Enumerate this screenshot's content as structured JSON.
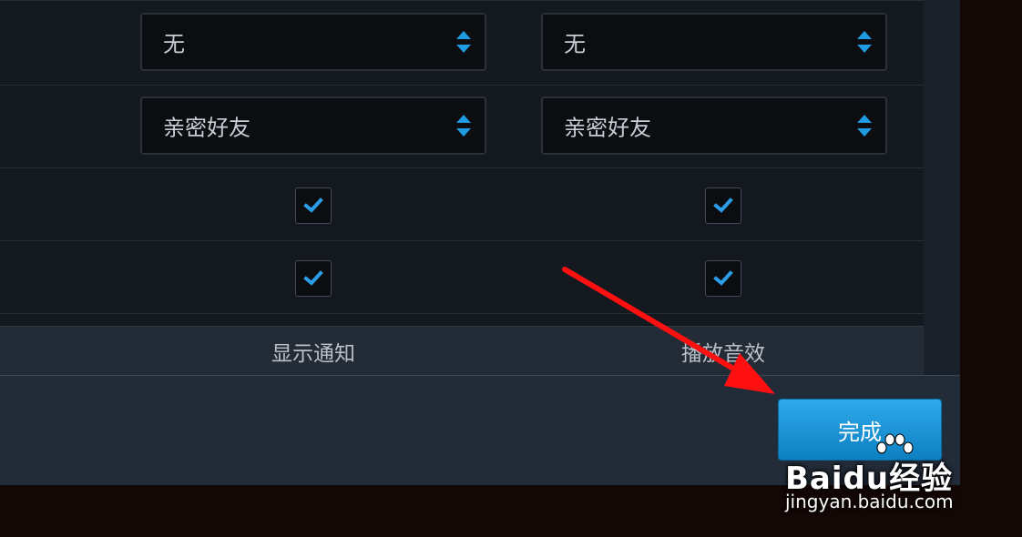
{
  "rows": [
    {
      "col1": {
        "type": "select",
        "value": "无"
      },
      "col2": {
        "type": "select",
        "value": "无"
      }
    },
    {
      "col1": {
        "type": "select",
        "value": "亲密好友"
      },
      "col2": {
        "type": "select",
        "value": "亲密好友"
      }
    },
    {
      "col1": {
        "type": "checkbox",
        "checked": true
      },
      "col2": {
        "type": "checkbox",
        "checked": true
      }
    },
    {
      "col1": {
        "type": "checkbox",
        "checked": true
      },
      "col2": {
        "type": "checkbox",
        "checked": true
      }
    }
  ],
  "columns": {
    "show_notification": "显示通知",
    "play_sound": "播放音效"
  },
  "footer": {
    "done_label": "完成"
  },
  "annotation": {
    "arrow_color": "#ff1010"
  },
  "watermark": {
    "brand_left": "Bai",
    "brand_mid": "du",
    "brand_cn": "经验",
    "url": "jingyan.baidu.com"
  },
  "colors": {
    "accent": "#1e9be0",
    "checkmark": "#2a9ee8",
    "panel": "#141920"
  }
}
